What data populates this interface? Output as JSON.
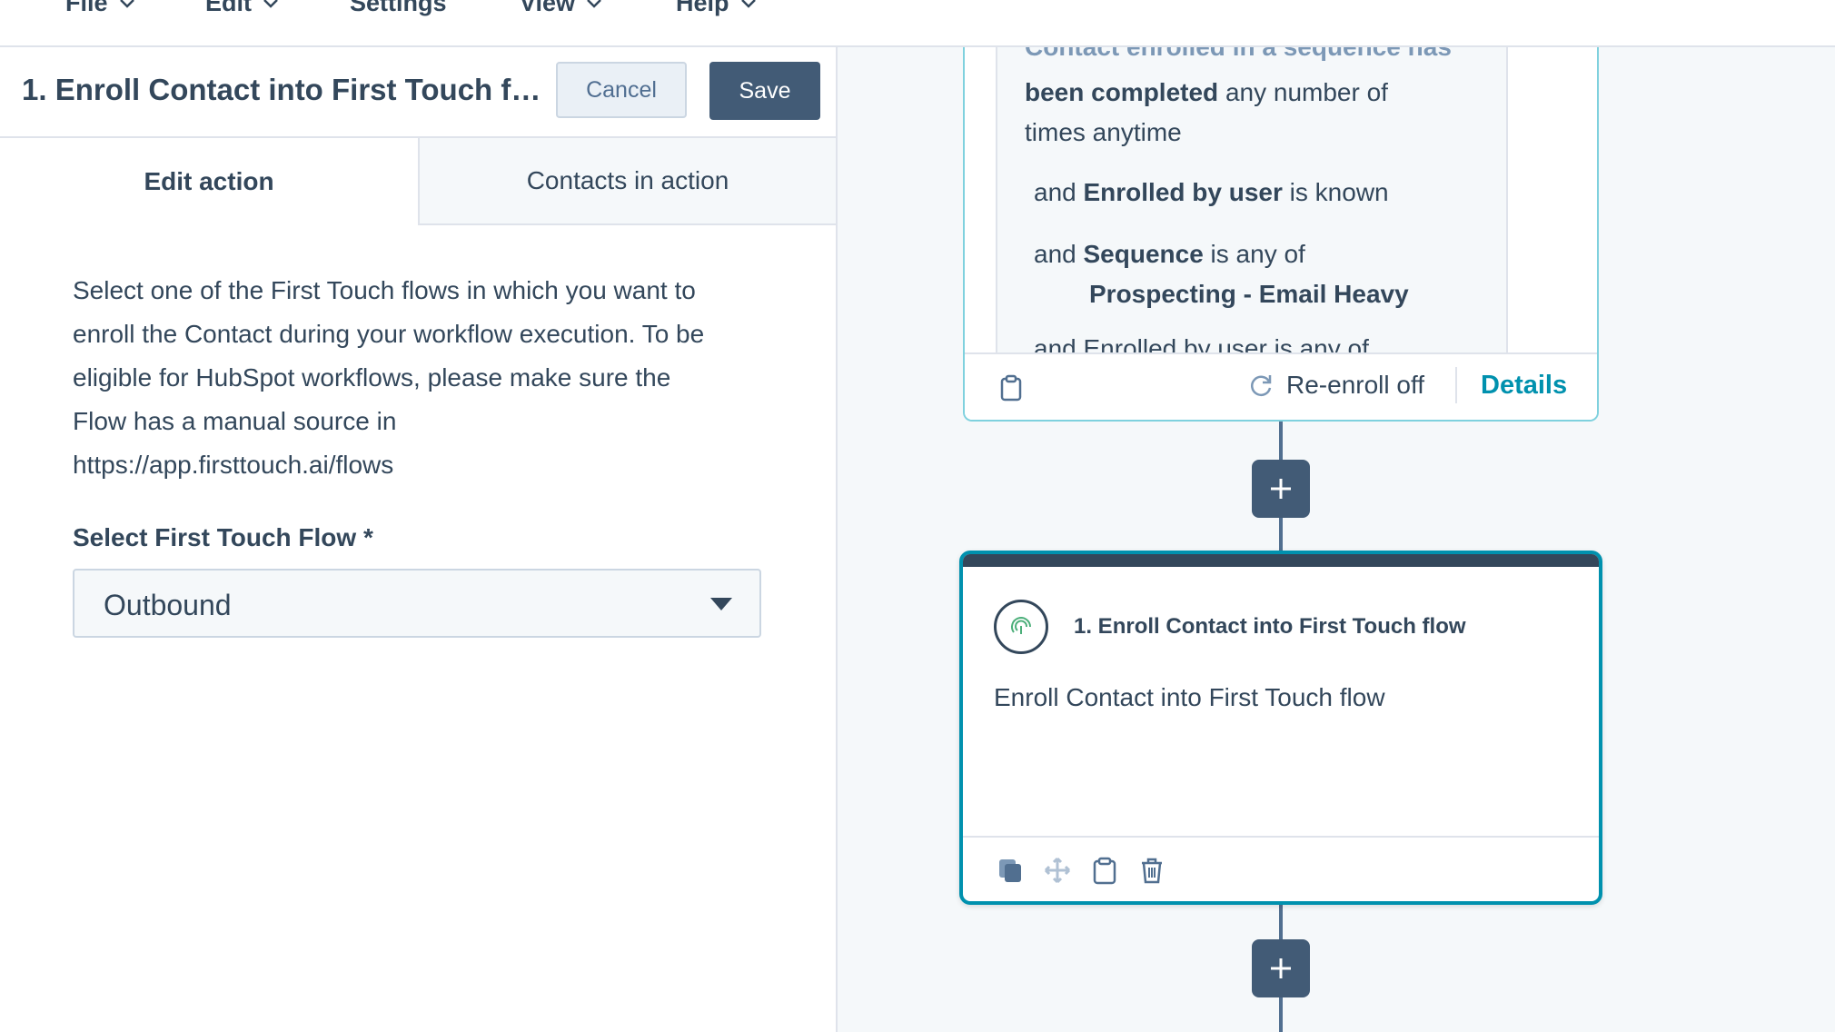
{
  "menubar": {
    "items": [
      {
        "label": "File"
      },
      {
        "label": "Edit"
      },
      {
        "label": "Settings"
      },
      {
        "label": "View"
      },
      {
        "label": "Help"
      }
    ]
  },
  "panel": {
    "title": "1. Enroll Contact into First Touch flow",
    "cancel_label": "Cancel",
    "save_label": "Save",
    "tabs": [
      {
        "label": "Edit action",
        "active": true
      },
      {
        "label": "Contacts in action",
        "active": false
      }
    ],
    "description_lines": [
      "Select one of the First Touch flows in which you want to",
      "enroll the Contact during your workflow execution. To be",
      "eligible for HubSpot workflows, please make sure the",
      "Flow has a manual source in",
      "https://app.firsttouch.ai/flows"
    ],
    "field_label": "Select First Touch Flow *",
    "select_value": "Outbound"
  },
  "trigger_card": {
    "line_partial": "Contact enrolled in a sequence has",
    "line2_bold": "been completed",
    "line2_rest": " any number of",
    "line3": "times anytime",
    "crit1_and": "and ",
    "crit1_bold": "Enrolled by user",
    "crit1_rest": " is known",
    "crit2_and": "and ",
    "crit2_bold": "Sequence",
    "crit2_rest": " is any of",
    "crit2_value": "Prospecting - Email Heavy",
    "crit3_partial": "and Enrolled by user is any of",
    "reenroll_label": "Re-enroll off",
    "details_label": "Details"
  },
  "action_card": {
    "title": "1. Enroll Contact into First Touch flow",
    "description": "Enroll Contact into First Touch flow"
  },
  "colors": {
    "accent": "#0091ae",
    "dark": "#33475b",
    "button": "#425b76",
    "border": "#dfe3eb"
  }
}
